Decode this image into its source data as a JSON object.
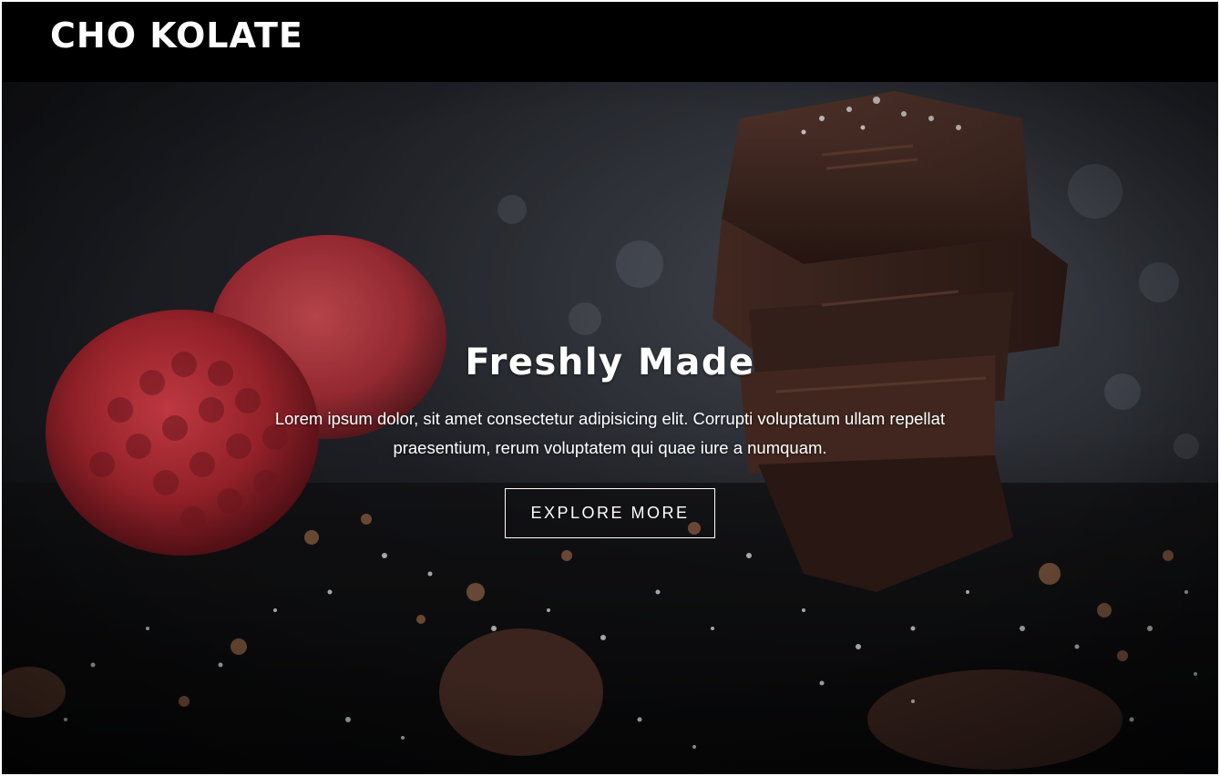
{
  "navbar": {
    "logo": "CHO KOLATE"
  },
  "hero": {
    "image_icon": "chocolate-raspberry-photo",
    "title": "Freshly Made",
    "text": "Lorem ipsum dolor, sit amet consectetur adipisicing elit. Corrupti voluptatum ullam repellat praesentium, rerum voluptatem qui quae iure a numquam.",
    "button_label": "EXPLORE MORE"
  },
  "colors": {
    "navbar_bg": "#000000",
    "text": "#ffffff",
    "chocolate": "#3b2620",
    "raspberry": "#b8303a"
  }
}
